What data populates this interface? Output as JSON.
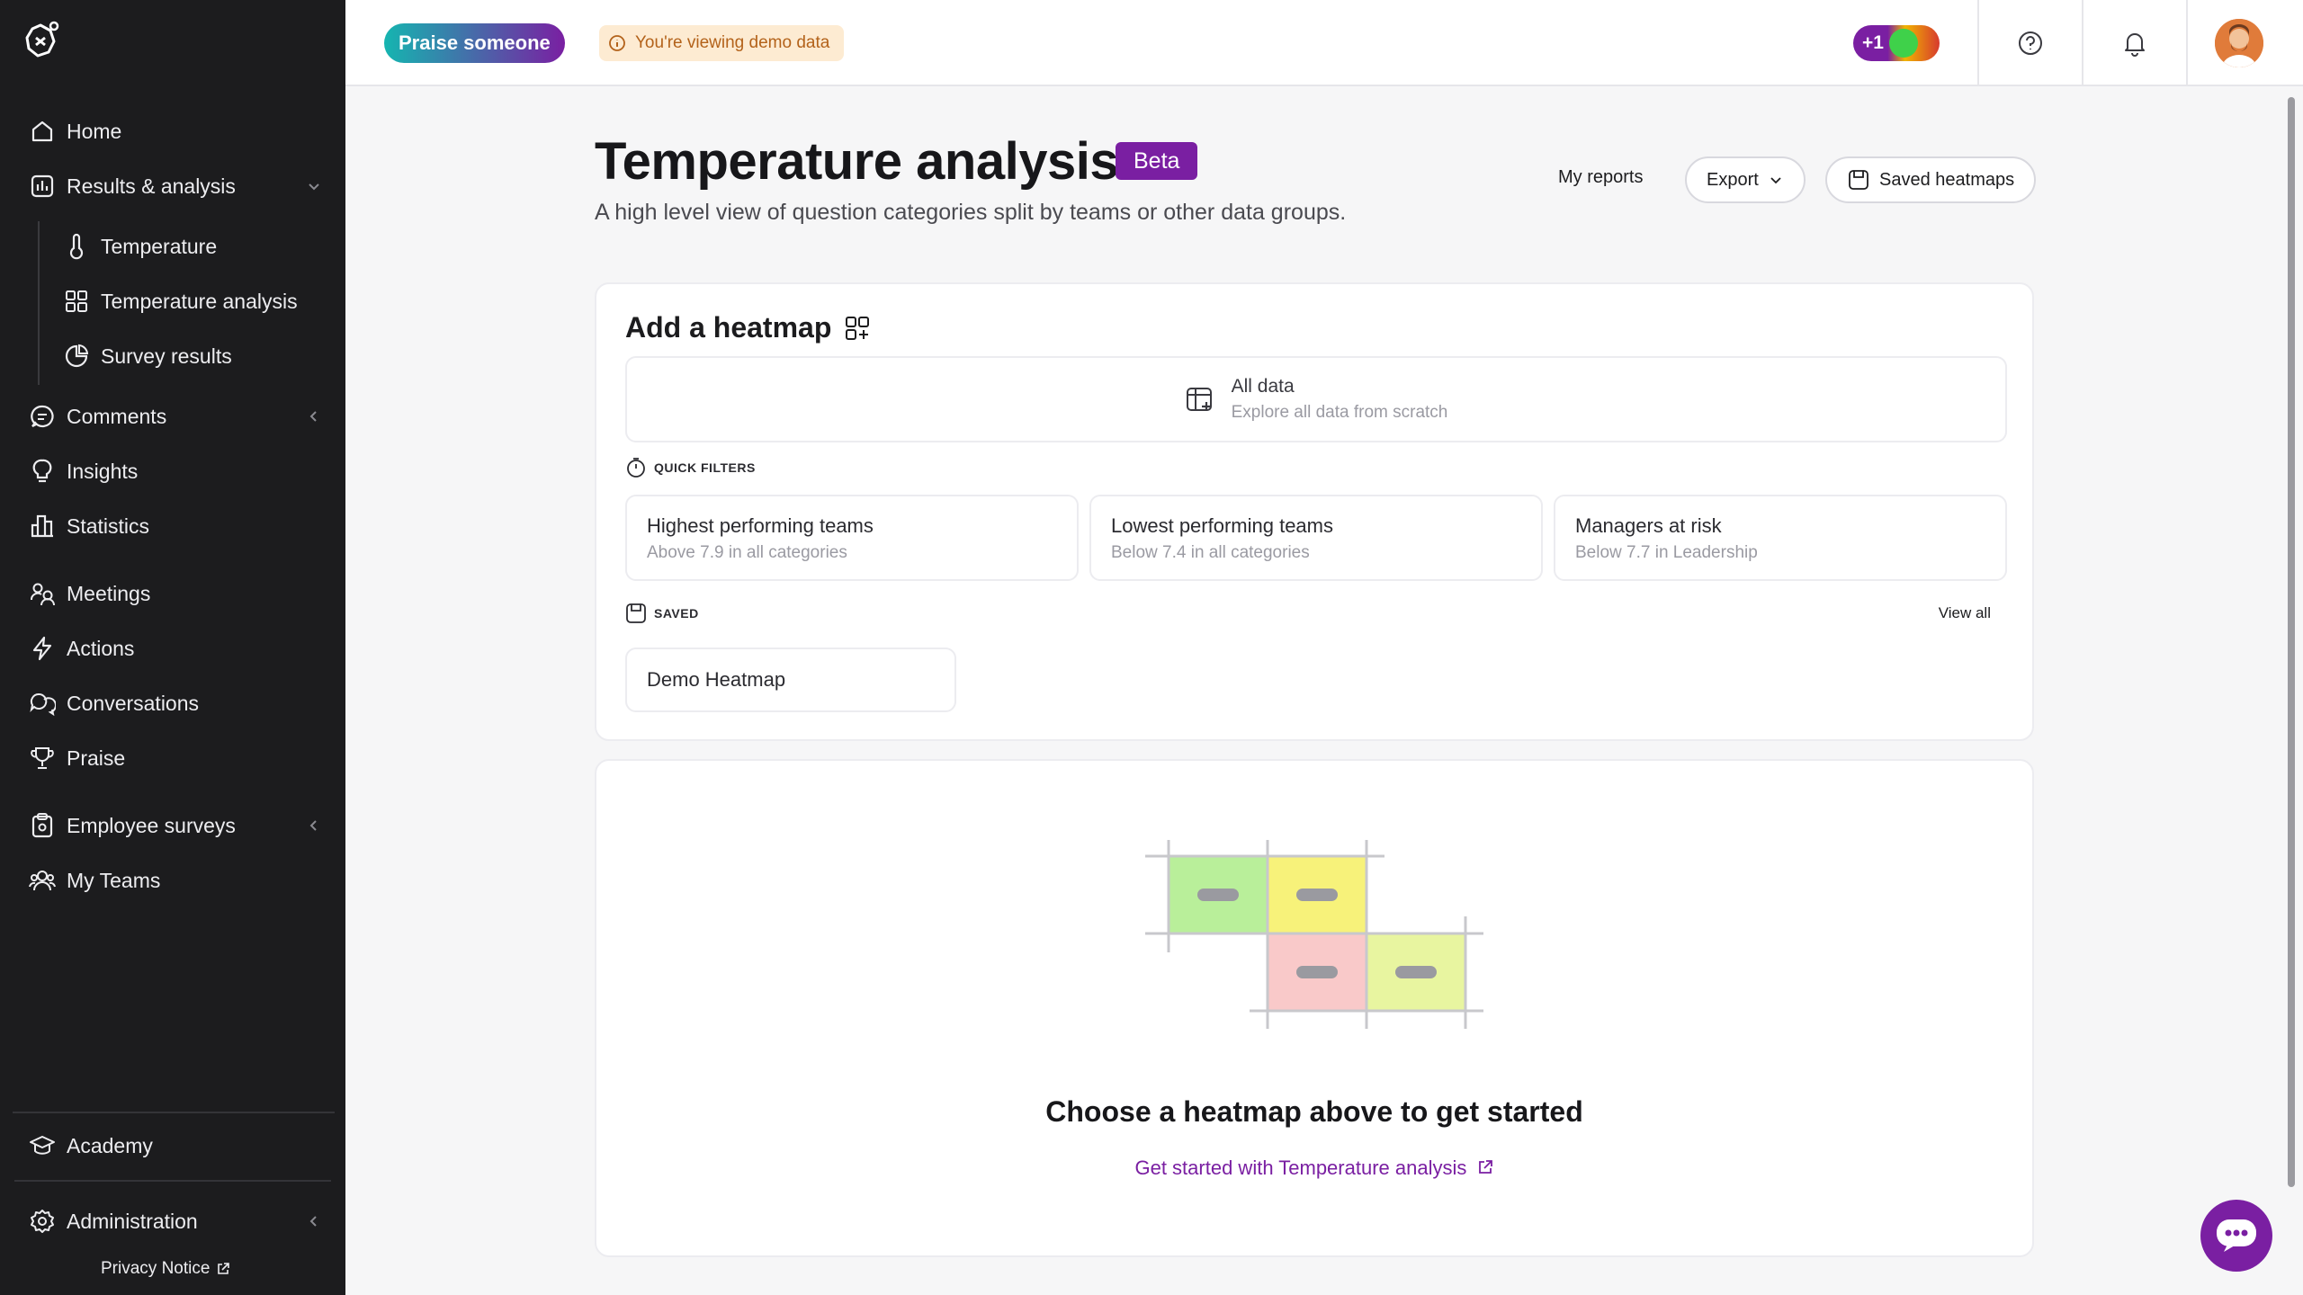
{
  "sidebar": {
    "items": [
      {
        "label": "Home",
        "icon": "home-icon"
      },
      {
        "label": "Results & analysis",
        "icon": "chart-icon"
      },
      {
        "label": "Temperature",
        "icon": "thermometer-icon"
      },
      {
        "label": "Temperature analysis",
        "icon": "grid-icon"
      },
      {
        "label": "Survey results",
        "icon": "pie-chart-icon"
      },
      {
        "label": "Comments",
        "icon": "comment-icon"
      },
      {
        "label": "Insights",
        "icon": "lightbulb-icon"
      },
      {
        "label": "Statistics",
        "icon": "bar-chart-icon"
      },
      {
        "label": "Meetings",
        "icon": "meeting-icon"
      },
      {
        "label": "Actions",
        "icon": "lightning-icon"
      },
      {
        "label": "Conversations",
        "icon": "chat-icon"
      },
      {
        "label": "Praise",
        "icon": "trophy-icon"
      },
      {
        "label": "Employee surveys",
        "icon": "clipboard-icon"
      },
      {
        "label": "My Teams",
        "icon": "people-icon"
      },
      {
        "label": "Academy",
        "icon": "graduation-cap-icon"
      },
      {
        "label": "Administration",
        "icon": "gear-icon"
      }
    ],
    "privacy_notice": "Privacy Notice"
  },
  "topbar": {
    "praise_button": "Praise someone",
    "demo_notice": "You're viewing demo data",
    "mood_badge": "+1"
  },
  "header": {
    "title": "Temperature analysis",
    "beta_badge": "Beta",
    "subtitle": "A high level view of question categories split by teams or other data groups.",
    "my_reports": "My reports",
    "export": "Export",
    "saved_heatmaps": "Saved heatmaps"
  },
  "add_heatmap": {
    "title": "Add a heatmap",
    "all_data": {
      "title": "All data",
      "description": "Explore all data from scratch"
    },
    "quick_filters_label": "QUICK FILTERS",
    "quick_filters": [
      {
        "title": "Highest performing teams",
        "description": "Above 7.9 in all categories"
      },
      {
        "title": "Lowest performing teams",
        "description": "Below 7.4 in all categories"
      },
      {
        "title": "Managers at risk",
        "description": "Below 7.7 in Leadership"
      }
    ],
    "saved_label": "SAVED",
    "view_all": "View all",
    "saved_items": [
      {
        "title": "Demo Heatmap"
      }
    ]
  },
  "empty_state": {
    "title": "Choose a heatmap above to get started",
    "link": "Get started with Temperature analysis"
  },
  "colors": {
    "sidebar_bg": "#1c1c1e",
    "accent": "#7a1fa2",
    "teal": "#15b5b0",
    "heat_green": "#b9ef9a",
    "heat_yellow": "#f7f27a",
    "heat_red": "#f9c9c9",
    "heat_lime": "#e8f5a0"
  }
}
